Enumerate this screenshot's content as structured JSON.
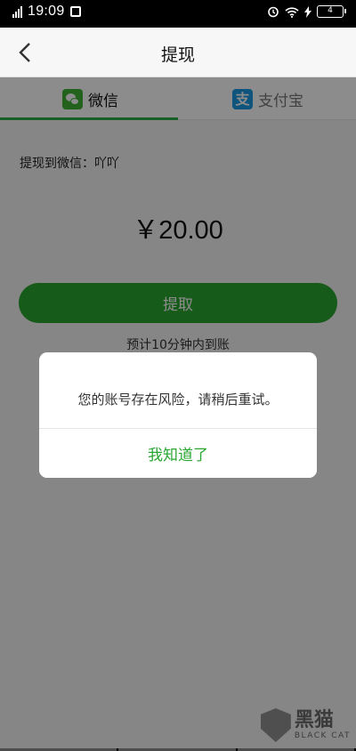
{
  "status_bar": {
    "time": "19:09",
    "battery": "4"
  },
  "nav": {
    "title": "提现"
  },
  "tabs": [
    {
      "label": "微信",
      "active": true
    },
    {
      "label": "支付宝",
      "active": false
    }
  ],
  "form": {
    "recipient": "提现到微信：吖吖",
    "amount": "￥20.00",
    "withdraw_label": "提取",
    "eta": "预计10分钟内到账"
  },
  "dialog": {
    "message": "您的账号存在风险，请稍后重试。",
    "confirm_label": "我知道了"
  },
  "watermark": {
    "cn": "黑猫",
    "en": "BLACK CAT"
  },
  "colors": {
    "accent": "#2aa631",
    "tab_underline": "#2aae42",
    "alipay": "#1c9ae2"
  },
  "icons": {
    "wechat_tab": "wechat-logo-icon",
    "alipay_tab": "alipay-logo-icon",
    "back": "chevron-left-icon",
    "alarm": "alarm-icon",
    "wifi": "wifi-icon",
    "battery": "battery-icon"
  }
}
